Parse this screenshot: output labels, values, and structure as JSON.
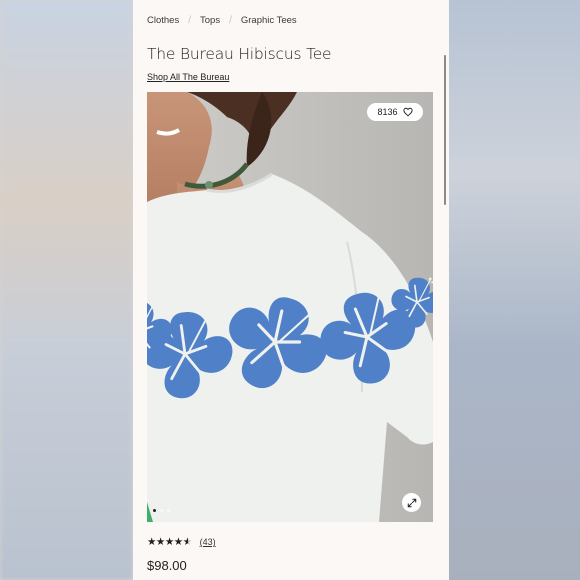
{
  "breadcrumb": [
    "Clothes",
    "Tops",
    "Graphic Tees"
  ],
  "product": {
    "title": "The Bureau Hibiscus Tee",
    "brand_link": "Shop All The Bureau",
    "likes": "8136",
    "rating": 4.5,
    "rating_count": "(43)",
    "price": "$98.00"
  },
  "carousel": {
    "total": 3,
    "active_index": 0
  },
  "icons": {
    "like": "heart-icon",
    "expand": "expand-icon"
  },
  "colors": {
    "hibiscus_blue": "#4f80c8",
    "shirt": "#eef1ee",
    "background": "#fbf8f6"
  }
}
